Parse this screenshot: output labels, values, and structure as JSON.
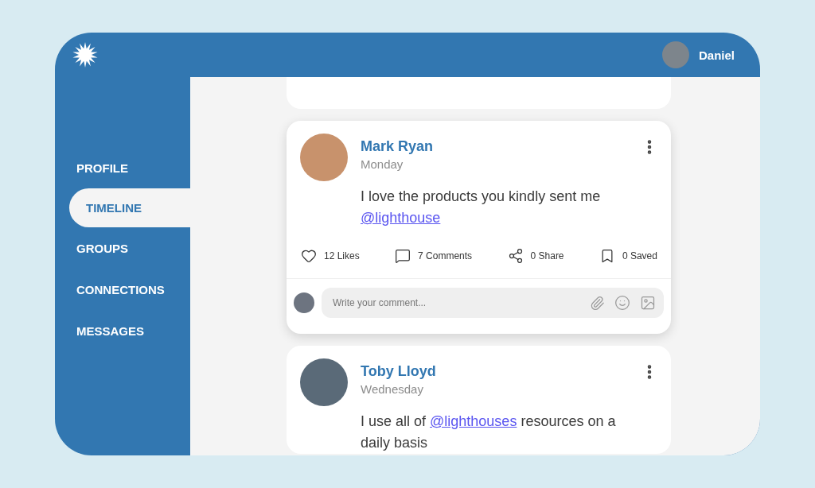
{
  "header": {
    "user": {
      "name": "Daniel"
    }
  },
  "nav": [
    {
      "label": "PROFILE",
      "selected": false
    },
    {
      "label": "TIMELINE",
      "selected": true
    },
    {
      "label": "GROUPS",
      "selected": false
    },
    {
      "label": "CONNECTIONS",
      "selected": false
    },
    {
      "label": "MESSAGES",
      "selected": false
    }
  ],
  "posts": [
    {
      "author": "Mark Ryan",
      "day": "Monday",
      "text_before": "I love the products you kindly sent me ",
      "mention": "@lighthouse",
      "stats": [
        {
          "kind": "likes",
          "label": "12 Likes"
        },
        {
          "kind": "comments",
          "label": "7 Comments"
        },
        {
          "kind": "share",
          "label": "0 Share"
        },
        {
          "kind": "saved",
          "label": "0 Saved"
        }
      ],
      "comment_field": {
        "placeholder": "Write your comment..."
      }
    },
    {
      "author": "Toby Lloyd",
      "day": "Wednesday",
      "text_before": "I use all of ",
      "mention": "@lighthouses",
      "text_after": " resources on a daily basis"
    }
  ]
}
